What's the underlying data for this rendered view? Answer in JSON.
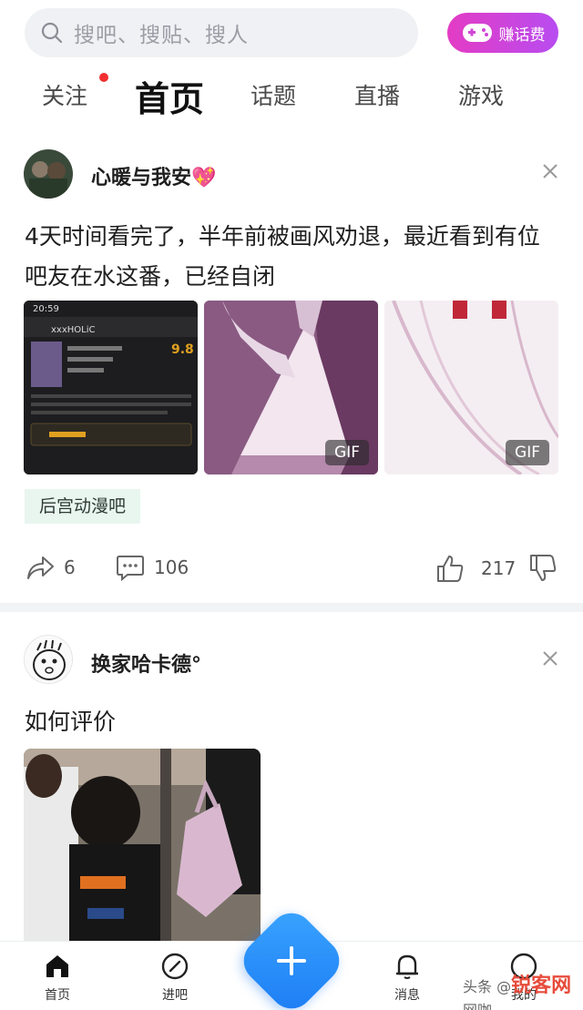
{
  "search": {
    "placeholder": "搜吧、搜贴、搜人"
  },
  "earn_button": {
    "label": "赚话费"
  },
  "tabs": [
    {
      "label": "关注"
    },
    {
      "label": "首页"
    },
    {
      "label": "话题"
    },
    {
      "label": "直播"
    },
    {
      "label": "游戏"
    }
  ],
  "posts": [
    {
      "author": "心暖与我安💖",
      "text": "4天时间看完了，半年前被画风劝退，最近看到有位吧友在水这番，已经自闭",
      "images": [
        {
          "kind": "screenshot",
          "time": "20:59",
          "title": "xxxHOLiC",
          "score": "9.8",
          "gif": ""
        },
        {
          "kind": "gif",
          "gif": "GIF"
        },
        {
          "kind": "gif",
          "gif": "GIF"
        }
      ],
      "tag": "后宫动漫吧",
      "shares": "6",
      "comments": "106",
      "likes": "217"
    },
    {
      "author": "换家哈卡德°",
      "text": "如何评价"
    }
  ],
  "bottom_nav": [
    {
      "label": "首页"
    },
    {
      "label": "进吧"
    },
    {
      "label": "消息"
    },
    {
      "label": "我的"
    }
  ],
  "watermark": {
    "brand": "锐客网",
    "prefix": "头条 @",
    "suffix": "网咖"
  },
  "colors": {
    "accent": "#1c7cf4",
    "highlight": "#ffe23b",
    "badge": "#f23030",
    "earn": "#d045d6"
  }
}
